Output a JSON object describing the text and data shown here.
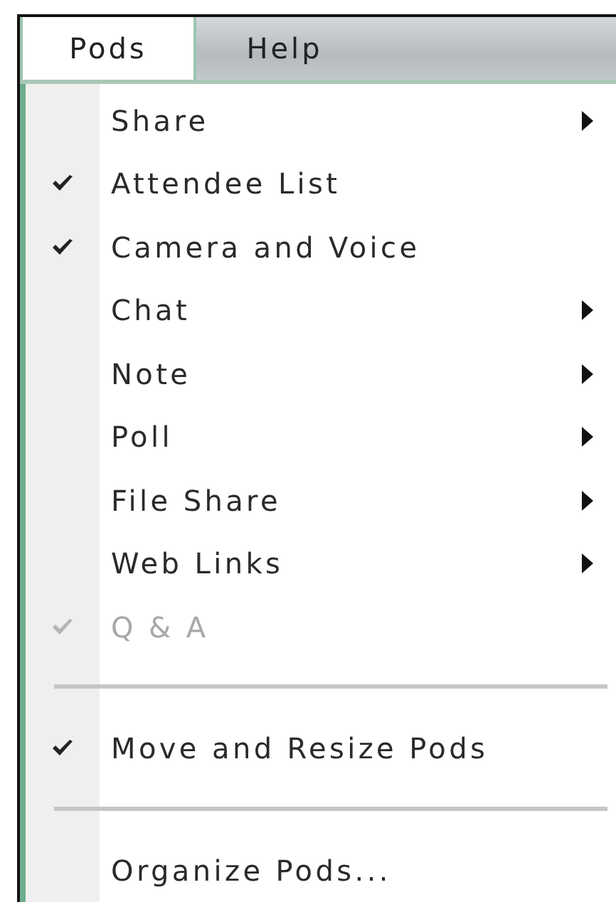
{
  "menubar": [
    {
      "label": "Pods",
      "selected": true
    },
    {
      "label": "Help",
      "selected": false
    }
  ],
  "menu": [
    {
      "kind": "item",
      "label": "Share",
      "checked": false,
      "submenu": true,
      "disabled": false
    },
    {
      "kind": "item",
      "label": "Attendee List",
      "checked": true,
      "submenu": false,
      "disabled": false
    },
    {
      "kind": "item",
      "label": "Camera and Voice",
      "checked": true,
      "submenu": false,
      "disabled": false
    },
    {
      "kind": "item",
      "label": "Chat",
      "checked": false,
      "submenu": true,
      "disabled": false
    },
    {
      "kind": "item",
      "label": "Note",
      "checked": false,
      "submenu": true,
      "disabled": false
    },
    {
      "kind": "item",
      "label": "Poll",
      "checked": false,
      "submenu": true,
      "disabled": false
    },
    {
      "kind": "item",
      "label": "File Share",
      "checked": false,
      "submenu": true,
      "disabled": false
    },
    {
      "kind": "item",
      "label": "Web Links",
      "checked": false,
      "submenu": true,
      "disabled": false
    },
    {
      "kind": "item",
      "label": "Q & A",
      "checked": true,
      "submenu": false,
      "disabled": true
    },
    {
      "kind": "separator"
    },
    {
      "kind": "item",
      "label": "Move and Resize Pods",
      "checked": true,
      "submenu": false,
      "disabled": false
    },
    {
      "kind": "separator"
    },
    {
      "kind": "item",
      "label": "Organize Pods...",
      "checked": false,
      "submenu": false,
      "disabled": false
    }
  ]
}
